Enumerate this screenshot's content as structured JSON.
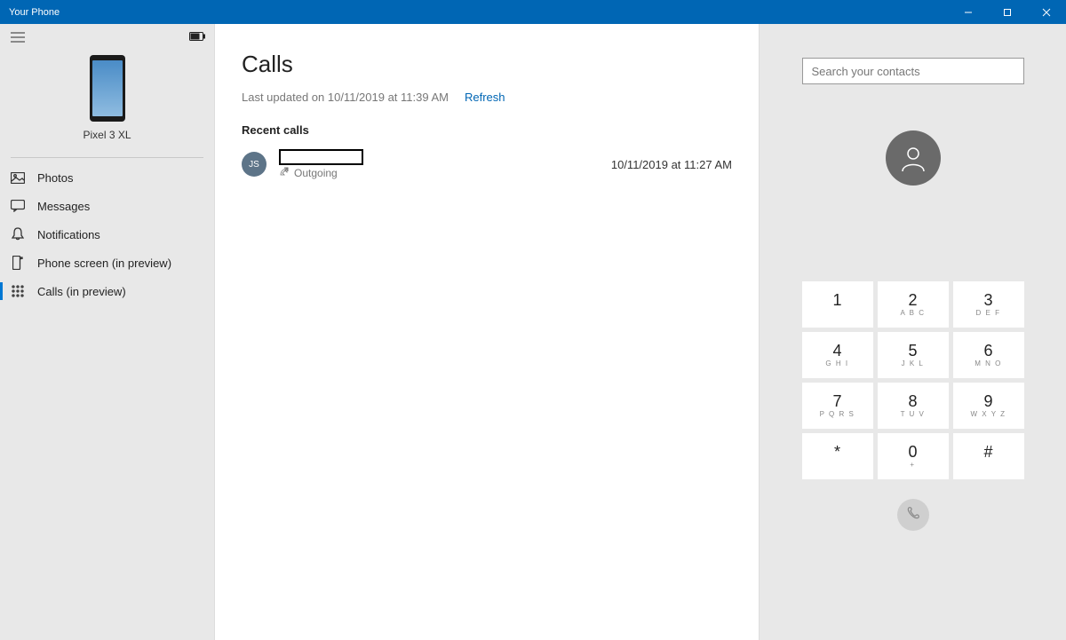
{
  "window": {
    "title": "Your Phone"
  },
  "sidebar": {
    "device_name": "Pixel 3 XL",
    "items": [
      {
        "label": "Photos"
      },
      {
        "label": "Messages"
      },
      {
        "label": "Notifications"
      },
      {
        "label": "Phone screen (in preview)"
      },
      {
        "label": "Calls (in preview)"
      }
    ]
  },
  "main": {
    "title": "Calls",
    "last_updated": "Last updated on 10/11/2019 at 11:39 AM",
    "refresh_label": "Refresh",
    "recent_heading": "Recent calls",
    "calls": [
      {
        "initials": "JS",
        "type_label": "Outgoing",
        "timestamp": "10/11/2019 at 11:27 AM"
      }
    ]
  },
  "dialer": {
    "search_placeholder": "Search your contacts",
    "keys": [
      {
        "digit": "1",
        "letters": ""
      },
      {
        "digit": "2",
        "letters": "A B C"
      },
      {
        "digit": "3",
        "letters": "D E F"
      },
      {
        "digit": "4",
        "letters": "G H I"
      },
      {
        "digit": "5",
        "letters": "J K L"
      },
      {
        "digit": "6",
        "letters": "M N O"
      },
      {
        "digit": "7",
        "letters": "P Q R S"
      },
      {
        "digit": "8",
        "letters": "T U V"
      },
      {
        "digit": "9",
        "letters": "W X Y Z"
      },
      {
        "digit": "*",
        "letters": ""
      },
      {
        "digit": "0",
        "letters": "+"
      },
      {
        "digit": "#",
        "letters": ""
      }
    ]
  }
}
